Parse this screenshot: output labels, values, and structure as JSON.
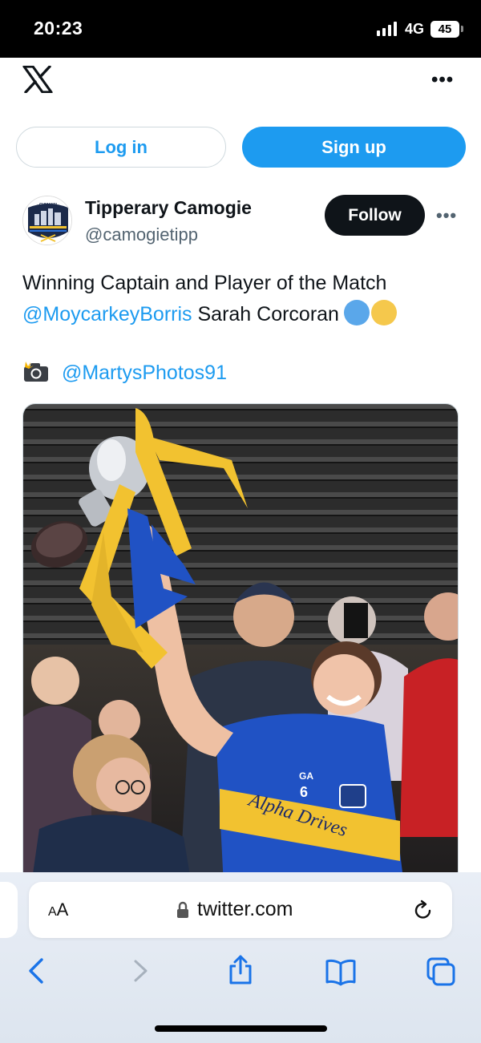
{
  "status_bar": {
    "time": "20:23",
    "network": "4G",
    "battery": "45"
  },
  "header": {
    "logo_icon": "x-logo-icon",
    "more_icon": "more-horizontal-icon",
    "more_symbol": "•••"
  },
  "auth": {
    "login_label": "Log in",
    "signup_label": "Sign up"
  },
  "tweet": {
    "author_name": "Tipperary Camogie",
    "author_handle": "@camogietipp",
    "follow_label": "Follow",
    "more_symbol": "•••",
    "text_line1": "Winning Captain and Player of the Match",
    "mention_team": "@MoycarkeyBorris",
    "text_after_mention": "Sarah Corcoran",
    "emoji_colors": [
      "#5aa7ea",
      "#f5c84c"
    ],
    "camera_icon": "camera-flash-icon",
    "photo_credit": "@MartysPhotos91",
    "photo": {
      "description_icon": "trophy-photo",
      "jersey_number": "6",
      "jersey_sponsor": "Alpha Drives",
      "jersey_brand": "GA"
    }
  },
  "browser": {
    "text_size_label_small": "A",
    "text_size_label_large": "A",
    "url": "twitter.com",
    "icons": [
      "back-icon",
      "forward-icon",
      "share-icon",
      "bookmarks-icon",
      "tabs-icon",
      "reload-icon",
      "lock-icon"
    ]
  },
  "colors": {
    "accent": "#1d9bf0",
    "text": "#0f1419",
    "secondary_text": "#536471"
  }
}
